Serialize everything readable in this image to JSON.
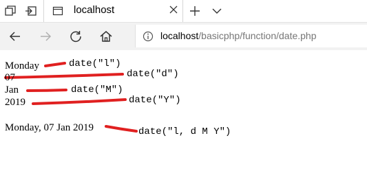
{
  "browser": {
    "tab_title": "localhost",
    "url_host": "localhost",
    "url_path": "/basicphp/function/date.php"
  },
  "output": {
    "day_name": "Monday",
    "day_num": "07",
    "month_short": "Jan",
    "year": "2019",
    "full_date": "Monday, 07 Jan 2019"
  },
  "annotations": {
    "fmt_l": "date(\"l\")",
    "fmt_d": "date(\"d\")",
    "fmt_M": "date(\"M\")",
    "fmt_Y": "date(\"Y\")",
    "fmt_full": "date(\"l, d M Y\")",
    "marker_color": "#e02020"
  },
  "icons": [
    "tab-list-icon",
    "set-aside-tabs-icon",
    "page-icon",
    "close-icon",
    "new-tab-icon",
    "chevron-down-icon",
    "back-icon",
    "forward-icon",
    "refresh-icon",
    "home-icon",
    "info-icon"
  ]
}
